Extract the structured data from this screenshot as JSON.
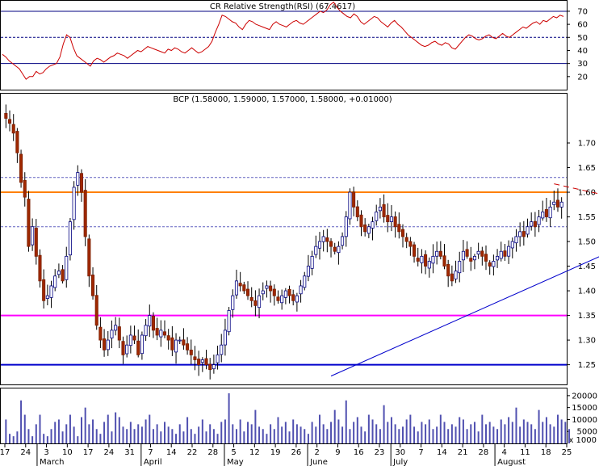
{
  "chart_data": [
    {
      "type": "line",
      "panel": "rsi",
      "title": "CR Relative Strength(RSI) (67.4617)",
      "ylim": [
        10,
        78
      ],
      "y_ticks": [
        20,
        30,
        40,
        50,
        60,
        70
      ],
      "reference_lines": [
        70,
        50,
        30
      ],
      "values": [
        37,
        35,
        32,
        30,
        28,
        26,
        22,
        18,
        20,
        20,
        24,
        22,
        23,
        26,
        28,
        29,
        30,
        35,
        45,
        52,
        50,
        42,
        36,
        34,
        32,
        30,
        28,
        32,
        34,
        33,
        31,
        33,
        35,
        36,
        38,
        37,
        36,
        34,
        36,
        38,
        40,
        39,
        41,
        43,
        42,
        41,
        40,
        39,
        38,
        41,
        40,
        42,
        41,
        39,
        38,
        40,
        42,
        40,
        38,
        39,
        41,
        43,
        47,
        54,
        60,
        67,
        66,
        64,
        62,
        61,
        58,
        56,
        60,
        63,
        62,
        60,
        59,
        58,
        57,
        56,
        60,
        62,
        60,
        59,
        58,
        60,
        62,
        63,
        61,
        60,
        62,
        64,
        66,
        68,
        70,
        69,
        71,
        75,
        77,
        73,
        70,
        68,
        66,
        65,
        68,
        66,
        62,
        60,
        62,
        64,
        66,
        65,
        62,
        60,
        58,
        61,
        63,
        60,
        58,
        55,
        52,
        50,
        48,
        46,
        44,
        43,
        44,
        46,
        47,
        45,
        44,
        46,
        45,
        42,
        41,
        44,
        47,
        50,
        52,
        51,
        49,
        48,
        49,
        51,
        52,
        50,
        49,
        51,
        53,
        51,
        50,
        52,
        54,
        56,
        58,
        57,
        59,
        61,
        62,
        60,
        63,
        62,
        64,
        66,
        65,
        67,
        66
      ]
    },
    {
      "type": "candlestick",
      "panel": "price",
      "title": "BCP (1.58000, 1.59000, 1.57000, 1.58000, +0.01000)",
      "ylim": [
        1.21,
        1.8
      ],
      "y_ticks": [
        1.25,
        1.3,
        1.35,
        1.4,
        1.45,
        1.5,
        1.55,
        1.6,
        1.65,
        1.7
      ],
      "horizontal_lines": [
        {
          "value": 1.6,
          "color": "#ff8000",
          "style": "solid"
        },
        {
          "value": 1.35,
          "color": "#ff00ff",
          "style": "solid"
        },
        {
          "value": 1.25,
          "color": "#0000cc",
          "style": "solid"
        },
        {
          "value": 1.63,
          "color": "#6060c0",
          "style": "dashed"
        },
        {
          "value": 1.53,
          "color": "#6060c0",
          "style": "dashed"
        }
      ],
      "trendlines": [
        {
          "from": [
            86,
            1.227
          ],
          "to": [
            185,
            1.565
          ],
          "color": "#0000cc",
          "style": "solid"
        },
        {
          "from": [
            145,
            1.617
          ],
          "to": [
            248,
            1.442
          ],
          "color": "#cc0000",
          "style": "dashed"
        }
      ],
      "closes": [
        1.75,
        1.74,
        1.72,
        1.68,
        1.62,
        1.59,
        1.49,
        1.53,
        1.47,
        1.42,
        1.38,
        1.39,
        1.41,
        1.43,
        1.44,
        1.42,
        1.47,
        1.54,
        1.61,
        1.64,
        1.6,
        1.51,
        1.43,
        1.39,
        1.33,
        1.3,
        1.28,
        1.3,
        1.32,
        1.33,
        1.3,
        1.27,
        1.29,
        1.31,
        1.3,
        1.27,
        1.31,
        1.33,
        1.35,
        1.32,
        1.31,
        1.32,
        1.31,
        1.3,
        1.28,
        1.3,
        1.3,
        1.29,
        1.28,
        1.27,
        1.26,
        1.25,
        1.26,
        1.25,
        1.24,
        1.25,
        1.27,
        1.29,
        1.32,
        1.36,
        1.39,
        1.42,
        1.41,
        1.4,
        1.39,
        1.38,
        1.37,
        1.39,
        1.4,
        1.41,
        1.4,
        1.39,
        1.38,
        1.39,
        1.4,
        1.39,
        1.38,
        1.39,
        1.41,
        1.43,
        1.45,
        1.47,
        1.49,
        1.5,
        1.51,
        1.5,
        1.49,
        1.48,
        1.49,
        1.51,
        1.55,
        1.6,
        1.57,
        1.55,
        1.53,
        1.52,
        1.53,
        1.54,
        1.56,
        1.57,
        1.55,
        1.54,
        1.55,
        1.53,
        1.52,
        1.51,
        1.5,
        1.49,
        1.47,
        1.46,
        1.47,
        1.45,
        1.46,
        1.47,
        1.48,
        1.47,
        1.45,
        1.43,
        1.42,
        1.44,
        1.46,
        1.48,
        1.47,
        1.46,
        1.47,
        1.48,
        1.47,
        1.46,
        1.45,
        1.46,
        1.47,
        1.48,
        1.47,
        1.49,
        1.5,
        1.51,
        1.52,
        1.51,
        1.53,
        1.54,
        1.53,
        1.55,
        1.56,
        1.55,
        1.57,
        1.58,
        1.57,
        1.58
      ]
    },
    {
      "type": "bar",
      "panel": "volume",
      "y_ticks": [
        5000,
        10000,
        15000,
        20000
      ],
      "y_multiplier_label": "x 1000",
      "values": [
        10,
        4,
        3,
        5,
        18,
        12,
        6,
        3,
        8,
        12,
        4,
        3,
        6,
        9,
        10,
        5,
        8,
        12,
        7,
        3,
        11,
        15,
        8,
        10,
        6,
        4,
        9,
        12,
        5,
        13,
        11,
        7,
        6,
        9,
        6,
        8,
        7,
        10,
        12,
        6,
        8,
        5,
        9,
        7,
        6,
        4,
        8,
        5,
        11,
        6,
        4,
        7,
        10,
        5,
        8,
        6,
        4,
        9,
        10,
        21,
        8,
        6,
        10,
        5,
        9,
        8,
        14,
        7,
        6,
        4,
        8,
        6,
        11,
        7,
        9,
        5,
        10,
        8,
        7,
        6,
        4,
        9,
        7,
        12,
        8,
        6,
        9,
        14,
        10,
        7,
        18,
        6,
        9,
        11,
        7,
        5,
        12,
        10,
        8,
        6,
        16,
        9,
        11,
        8,
        6,
        7,
        10,
        12,
        7,
        5,
        9,
        8,
        10,
        6,
        7,
        12,
        9,
        6,
        8,
        7,
        11,
        10,
        6,
        8,
        9,
        5,
        12,
        8,
        9,
        7,
        6,
        10,
        8,
        11,
        9,
        15,
        7,
        10,
        9,
        8,
        6,
        14,
        9,
        11,
        8,
        7,
        12,
        10,
        9,
        6
      ]
    }
  ],
  "x_axis": {
    "day_labels": [
      "17",
      "24",
      "3",
      "10",
      "17",
      "24",
      "31",
      "7",
      "14",
      "22",
      "28",
      "5",
      "12",
      "19",
      "26",
      "2",
      "9",
      "16",
      "23",
      "30",
      "7",
      "14",
      "21",
      "28",
      "4",
      "11",
      "18",
      "25"
    ],
    "month_labels": [
      "March",
      "April",
      "May",
      "June",
      "July",
      "August"
    ]
  }
}
